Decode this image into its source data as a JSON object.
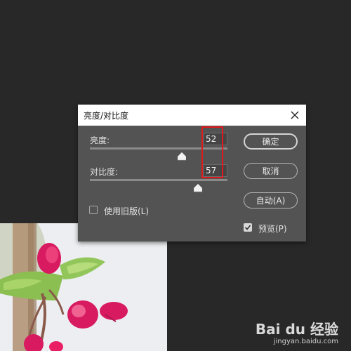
{
  "dialog": {
    "title": "亮度/对比度",
    "brightness": {
      "label": "亮度:",
      "value": "52",
      "slider_fraction": 0.67
    },
    "contrast": {
      "label": "对比度:",
      "value": "57",
      "slider_fraction": 0.785
    },
    "legacy_checkbox": {
      "label": "使用旧版(L)",
      "checked": false
    },
    "preview_checkbox": {
      "label": "预览(P)",
      "checked": true
    },
    "buttons": {
      "ok": "确定",
      "cancel": "取消",
      "auto": "自动(A)"
    }
  },
  "watermark": {
    "brand": "Bai du 经验",
    "url": "jingyan.baidu.com"
  },
  "colors": {
    "app_bg": "#282828",
    "dialog_bg": "#535353",
    "highlight_box": "#e0191c"
  }
}
